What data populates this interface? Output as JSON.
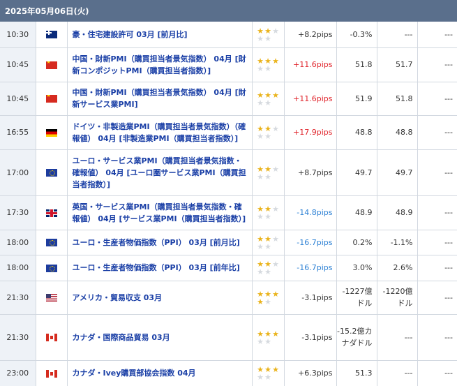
{
  "header": {
    "date": "2025年05月06日(火)"
  },
  "rows": [
    {
      "time": "10:30",
      "country": "au",
      "flag_icon": "australia-flag-icon",
      "title": "豪・住宅建設許可 03月 [前月比]",
      "stars": 2,
      "pips": "+8.2pips",
      "pips_dir": "neutral",
      "result": "-0.3%",
      "forecast": "---",
      "previous": "---",
      "h": 37
    },
    {
      "time": "10:45",
      "country": "cn",
      "flag_icon": "china-flag-icon",
      "title": "中国・財新PMI（購買担当者景気指数） 04月 [財新コンポジットPMI（購買担当者指数）]",
      "stars": 3,
      "pips": "+11.6pips",
      "pips_dir": "up",
      "result": "51.8",
      "forecast": "51.7",
      "previous": "---",
      "h": 49
    },
    {
      "time": "10:45",
      "country": "cn",
      "flag_icon": "china-flag-icon",
      "title": "中国・財新PMI（購買担当者景気指数） 04月 [財新サービス業PMI]",
      "stars": 3,
      "pips": "+11.6pips",
      "pips_dir": "up",
      "result": "51.9",
      "forecast": "51.8",
      "previous": "---",
      "h": 48
    },
    {
      "time": "16:55",
      "country": "de",
      "flag_icon": "germany-flag-icon",
      "title": "ドイツ・非製造業PMI（購買担当者景気指数）（確報値） 04月 [非製造業PMI（購買担当者指数）]",
      "stars": 2,
      "pips": "+17.9pips",
      "pips_dir": "up",
      "result": "48.8",
      "forecast": "48.8",
      "previous": "---",
      "h": 49
    },
    {
      "time": "17:00",
      "country": "eu",
      "flag_icon": "eu-flag-icon",
      "title": "ユーロ・サービス業PMI（購買担当者景気指数・確報値） 04月 [ユーロ圏サービス業PMI（購買担当者指数）]",
      "stars": 2,
      "pips": "+8.7pips",
      "pips_dir": "neutral",
      "result": "49.7",
      "forecast": "49.7",
      "previous": "---",
      "h": 66
    },
    {
      "time": "17:30",
      "country": "gb",
      "flag_icon": "uk-flag-icon",
      "title": "英国・サービス業PMI（購買担当者景気指数・確報値） 04月 [サービス業PMI（購買担当者指数）]",
      "stars": 2,
      "pips": "-14.8pips",
      "pips_dir": "down",
      "result": "48.9",
      "forecast": "48.9",
      "previous": "---",
      "h": 49
    },
    {
      "time": "18:00",
      "country": "eu",
      "flag_icon": "eu-flag-icon",
      "title": "ユーロ・生産者物価指数（PPI） 03月 [前月比]",
      "stars": 2,
      "pips": "-16.7pips",
      "pips_dir": "down",
      "result": "0.2%",
      "forecast": "-1.1%",
      "previous": "---",
      "h": 36
    },
    {
      "time": "18:00",
      "country": "eu",
      "flag_icon": "eu-flag-icon",
      "title": "ユーロ・生産者物価指数（PPI） 03月 [前年比]",
      "stars": 2,
      "pips": "-16.7pips",
      "pips_dir": "down",
      "result": "3.0%",
      "forecast": "2.6%",
      "previous": "---",
      "h": 37
    },
    {
      "time": "21:30",
      "country": "us",
      "flag_icon": "usa-flag-icon",
      "title": "アメリカ・貿易収支 03月",
      "stars": 4,
      "pips": "-3.1pips",
      "pips_dir": "neutral",
      "result": "-1227億ドル",
      "forecast": "-1220億ドル",
      "previous": "---",
      "h": 48
    },
    {
      "time": "21:30",
      "country": "ca",
      "flag_icon": "canada-flag-icon",
      "title": "カナダ・国際商品貿易 03月",
      "stars": 3,
      "pips": "-3.1pips",
      "pips_dir": "neutral",
      "result": "-15.2億カナダドル",
      "forecast": "---",
      "previous": "---",
      "h": 66
    },
    {
      "time": "23:00",
      "country": "ca",
      "flag_icon": "canada-flag-icon",
      "title": "カナダ・Ivey購買部協会指数 04月",
      "stars": 3,
      "pips": "+6.3pips",
      "pips_dir": "neutral",
      "result": "51.3",
      "forecast": "---",
      "previous": "---",
      "h": 37
    }
  ],
  "star_icon": "star-icon",
  "colors": {
    "header_bg": "#5a6f8c",
    "title_link": "#1a3fa6",
    "pips_up": "#e0232a",
    "pips_down": "#2a7fd4",
    "star_on": "#eab31b",
    "star_off": "#d6dadf"
  }
}
